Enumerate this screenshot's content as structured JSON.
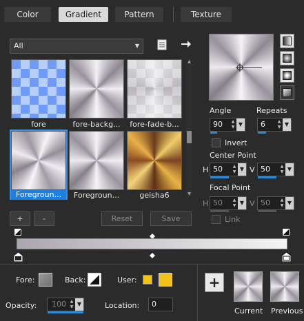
{
  "tabs": [
    {
      "label": "Color"
    },
    {
      "label": "Gradient"
    },
    {
      "label": "Pattern"
    },
    {
      "label": "Texture"
    }
  ],
  "category_dropdown": {
    "value": "All"
  },
  "gradients": [
    {
      "label": "fore"
    },
    {
      "label": "fore-backg..."
    },
    {
      "label": "fore-fade-b..."
    },
    {
      "label": "Foregroun..."
    },
    {
      "label": "Foregroun..."
    },
    {
      "label": "geisha6"
    }
  ],
  "list_buttons": {
    "add": "+",
    "remove": "-",
    "reset": "Reset",
    "save": "Save"
  },
  "angle": {
    "label": "Angle",
    "value": "90"
  },
  "repeats": {
    "label": "Repeats",
    "value": "6"
  },
  "invert": {
    "label": "Invert"
  },
  "center_point": {
    "label": "Center Point",
    "h_label": "H",
    "h_value": "50",
    "v_label": "V",
    "v_value": "50"
  },
  "focal_point": {
    "label": "Focal Point",
    "h_label": "H",
    "h_value": "50",
    "v_label": "V",
    "v_value": "50"
  },
  "link": {
    "label": "Link"
  },
  "bottom": {
    "fore_label": "Fore:",
    "back_label": "Back:",
    "user_label": "User:",
    "opacity_label": "Opacity:",
    "opacity_value": "100",
    "location_label": "Location:",
    "location_value": "0",
    "add_button": "+",
    "current_label": "Current",
    "previous_label": "Previous"
  },
  "colors": {
    "accent": "#2d8ad8",
    "user_color": "#f2c21b",
    "panel": "#2b2b2b"
  },
  "icons": [
    "document-icon",
    "arrow-right-icon",
    "shape-linear-icon",
    "shape-rectangular-icon",
    "shape-sunburst-icon",
    "shape-radial-icon"
  ]
}
